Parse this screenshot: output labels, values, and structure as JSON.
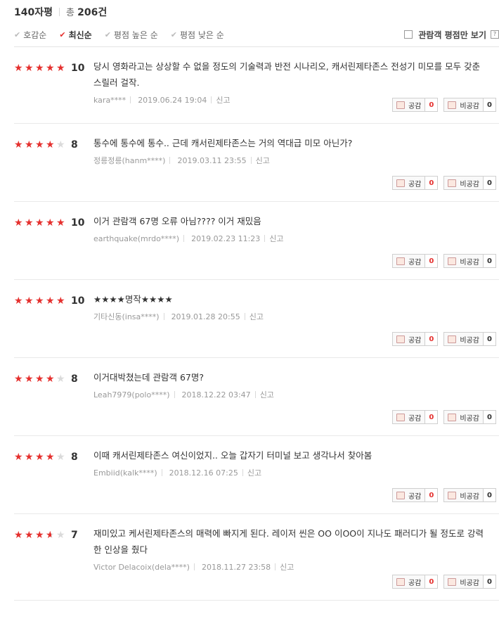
{
  "header": {
    "title": "140자평",
    "total_prefix": "총",
    "total_count": "206건"
  },
  "sort": {
    "options": [
      "호감순",
      "최신순",
      "평점 높은 순",
      "평점 낮은 순"
    ],
    "active_index": 1,
    "viewer_only_label": "관람객 평점만 보기",
    "help_label": "?"
  },
  "labels": {
    "like": "공감",
    "dislike": "비공감",
    "report": "신고"
  },
  "colors": {
    "accent": "#e5302e",
    "star_off": "#dadada"
  },
  "reviews": [
    {
      "stars": 5,
      "score": "10",
      "text": "당시 영화라고는 상상할 수 없을 정도의 기술력과 반전 시나리오, 캐서린제타존스 전성기 미모를 모두 갖춘 스릴러 걸작.",
      "user": "kara****",
      "date": "2019.06.24 19:04",
      "likes": "0",
      "dislikes": "0"
    },
    {
      "stars": 4,
      "score": "8",
      "text": "통수에 통수에 통수.. 근데 캐서린제타존스는 거의 역대급 미모 아닌가?",
      "user": "정릉정릉(hanm****)",
      "date": "2019.03.11 23:55",
      "likes": "0",
      "dislikes": "0"
    },
    {
      "stars": 5,
      "score": "10",
      "text": "이거 관람객 67명 오류 아님???? 이거 재밌음",
      "user": "earthquake(mrdo****)",
      "date": "2019.02.23 11:23",
      "likes": "0",
      "dislikes": "0"
    },
    {
      "stars": 5,
      "score": "10",
      "text": "★★★★명작★★★★",
      "user": "기타신동(insa****)",
      "date": "2019.01.28 20:55",
      "likes": "0",
      "dislikes": "0"
    },
    {
      "stars": 4,
      "score": "8",
      "text": "이거대박쳤는데 관람객 67명?",
      "user": "Leah7979(polo****)",
      "date": "2018.12.22 03:47",
      "likes": "0",
      "dislikes": "0"
    },
    {
      "stars": 4,
      "score": "8",
      "text": "이때 캐서린제타존스 여신이었지.. 오늘 갑자기 터미널 보고 생각나서 찾아봄",
      "user": "Embiid(kalk****)",
      "date": "2018.12.16 07:25",
      "likes": "0",
      "dislikes": "0"
    },
    {
      "stars": 3.5,
      "score": "7",
      "text": "재미있고 케서린제타존스의 매력에 빠지게 된다. 레이저 씬은 OO 이OO이 지나도 패러디가 될 정도로 강력한 인상을 줬다",
      "user": "Victor Delacoix(dela****)",
      "date": "2018.11.27 23:58",
      "likes": "0",
      "dislikes": "0"
    }
  ]
}
